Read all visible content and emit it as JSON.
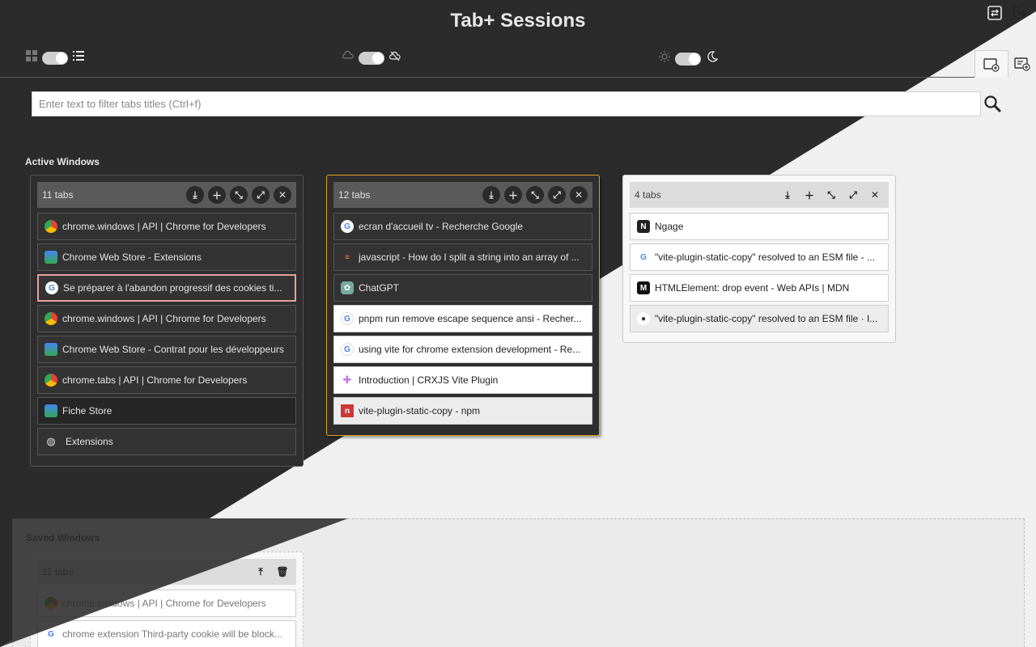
{
  "app": {
    "title": "Tab+ Sessions"
  },
  "top_icons": [
    "sessions-swap-icon",
    "logout-icon"
  ],
  "toggles": [
    {
      "left_icon": "grid-view-icon",
      "right_icon": "list-view-icon"
    },
    {
      "left_icon": "cloud-icon",
      "right_icon": "cloud-off-icon"
    },
    {
      "left_icon": "sun-icon",
      "right_icon": "moon-icon"
    }
  ],
  "search": {
    "placeholder": "Enter text to filter tabs titles (Ctrl+f)"
  },
  "sections": {
    "active": "Active Windows",
    "saved": "Saved Windows"
  },
  "active_windows": [
    {
      "count": "11 tabs",
      "tabs": [
        {
          "title": "chrome.windows | API | Chrome for Developers",
          "icon": "chrome"
        },
        {
          "title": "Chrome Web Store - Extensions",
          "icon": "webstore"
        },
        {
          "title": "Se préparer à l'abandon progressif des cookies ti...",
          "icon": "google"
        },
        {
          "title": "chrome.windows | API | Chrome for Developers",
          "icon": "chrome"
        },
        {
          "title": "Chrome Web Store - Contrat pour les développeurs",
          "icon": "webstore"
        },
        {
          "title": "chrome.tabs | API | Chrome for Developers",
          "icon": "chrome"
        },
        {
          "title": "Fiche Store",
          "icon": "webstore"
        },
        {
          "title": "Extensions",
          "icon": "globe"
        }
      ]
    },
    {
      "count": "12 tabs",
      "tabs": [
        {
          "title": "ecran d'accueil tv - Recherche Google",
          "icon": "google"
        },
        {
          "title": "javascript - How do I split a string into an array of ...",
          "icon": "stackoverflow"
        },
        {
          "title": "ChatGPT",
          "icon": "chatgpt"
        },
        {
          "title": "pnpm run remove escape sequence ansi - Recher...",
          "icon": "google"
        },
        {
          "title": "using vite for chrome extension development - Re...",
          "icon": "google"
        },
        {
          "title": "Introduction | CRXJS Vite Plugin",
          "icon": "puzzle"
        },
        {
          "title": "vite-plugin-static-copy - npm",
          "icon": "npm"
        }
      ]
    },
    {
      "count": "4 tabs",
      "tabs": [
        {
          "title": "Ngage",
          "icon": "ngage"
        },
        {
          "title": "\"vite-plugin-static-copy\" resolved to an ESM file - ...",
          "icon": "google"
        },
        {
          "title": "HTMLElement: drop event - Web APIs | MDN",
          "icon": "mdn"
        },
        {
          "title": "\"vite-plugin-static-copy\" resolved to an ESM file · I...",
          "icon": "github"
        }
      ]
    }
  ],
  "saved_windows": [
    {
      "count": "11 tabs",
      "tabs": [
        {
          "title": "chrome.windows | API | Chrome for Developers",
          "icon": "chrome"
        },
        {
          "title": "chrome extension Third-party cookie will be block...",
          "icon": "google"
        }
      ]
    }
  ],
  "colors": {
    "dark_bg": "#2b2b2b",
    "light_bg": "#f0f0f0",
    "focus_border": "#e0a020",
    "selected_border": "#e9a0a0"
  }
}
